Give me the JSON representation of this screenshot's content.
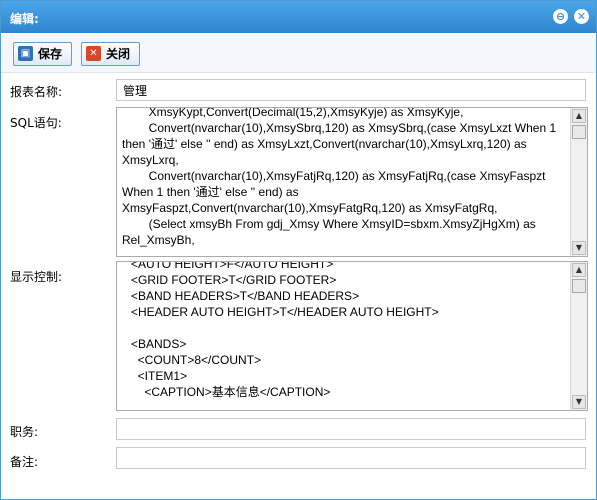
{
  "window": {
    "title": "编辑:",
    "minimize_glyph": "⊖",
    "close_glyph": "✕"
  },
  "toolbar": {
    "save_label": "保存",
    "save_icon": "floppy-disk-icon",
    "close_label": "关闭",
    "close_icon": "close-x-icon"
  },
  "form": {
    "report_name_label": "报表名称:",
    "report_name_value": "管理",
    "sql_label": "SQL语句:",
    "sql_text": "        XmsyKypt,Convert(Decimal(15,2),XmsyKyje) as XmsyKyje,\n        Convert(nvarchar(10),XmsySbrq,120) as XmsySbrq,(case XmsyLxzt When 1 then '通过' else '' end) as XmsyLxzt,Convert(nvarchar(10),XmsyLxrq,120) as XmsyLxrq,\n        Convert(nvarchar(10),XmsyFatjRq,120) as XmsyFatjRq,(case XmsyFaspzt When 1 then '通过' else '' end) as XmsyFaspzt,Convert(nvarchar(10),XmsyFatgRq,120) as XmsyFatgRq,\n        (Select xmsyBh From gdj_Xmsy Where XmsyID=sbxm.XmsyZjHgXm) as Rel_XmsyBh,",
    "display_label": "显示控制:",
    "display_text": "<AUTO HEIGHT>F</AUTO HEIGHT>\n<GRID FOOTER>T</GRID FOOTER>\n<BAND HEADERS>T</BAND HEADERS>\n<HEADER AUTO HEIGHT>T</HEADER AUTO HEIGHT>\n\n<BANDS>\n  <COUNT>8</COUNT>\n  <ITEM1>\n    <CAPTION>基本信息</CAPTION>",
    "duty_label": "职务:",
    "duty_value": "",
    "remark_label": "备注:",
    "remark_value": ""
  },
  "scroll": {
    "up_glyph": "▲",
    "down_glyph": "▼"
  },
  "colors": {
    "titlebar": "#3b95dc",
    "save_icon": "#2f6fb5",
    "close_icon": "#d9472b"
  }
}
